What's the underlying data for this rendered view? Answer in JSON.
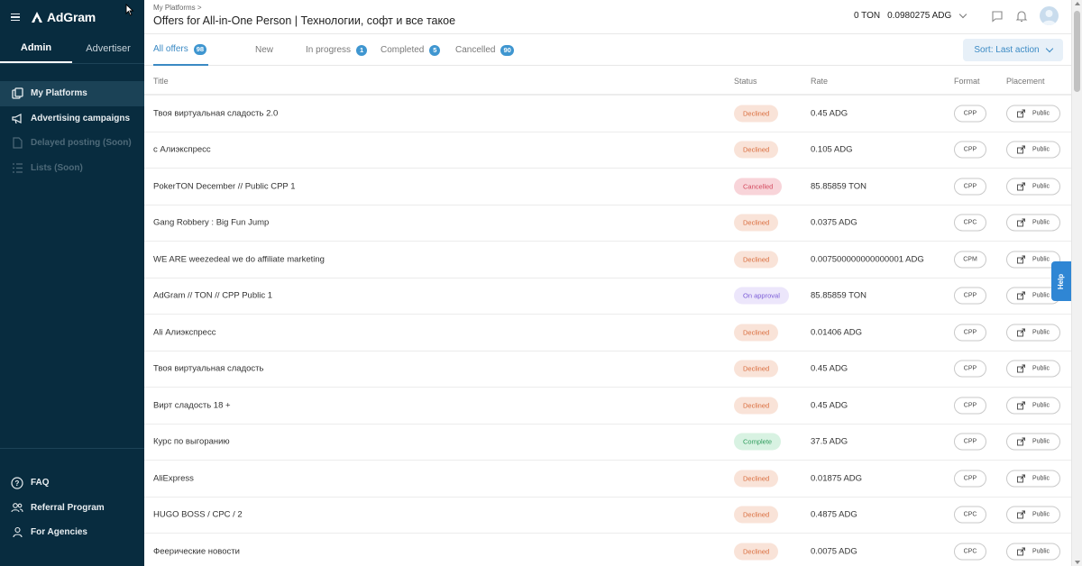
{
  "app": {
    "name": "AdGram"
  },
  "sidebar": {
    "tabs": [
      "Admin",
      "Advertiser"
    ],
    "items": [
      {
        "label": "My Platforms",
        "icon": "platforms-icon",
        "active": true,
        "disabled": false
      },
      {
        "label": "Advertising campaigns",
        "icon": "megaphone-icon",
        "active": false,
        "disabled": false
      },
      {
        "label": "Delayed posting (Soon)",
        "icon": "document-icon",
        "active": false,
        "disabled": true
      },
      {
        "label": "Lists (Soon)",
        "icon": "list-icon",
        "active": false,
        "disabled": true
      }
    ],
    "bottom_items": [
      {
        "label": "FAQ",
        "icon": "question-icon"
      },
      {
        "label": "Referral Program",
        "icon": "people-icon"
      },
      {
        "label": "For Agencies",
        "icon": "person-icon"
      }
    ]
  },
  "header": {
    "breadcrumb": "My Platforms",
    "title": "Offers for All-in-One Person | Технологии, софт и все такое",
    "balance_ton": "0 TON",
    "balance_adg": "0.0980275 ADG"
  },
  "tabs": [
    {
      "label": "All offers",
      "count": "98",
      "active": true
    },
    {
      "label": "New",
      "count": null,
      "active": false
    },
    {
      "label": "In progress",
      "count": "1",
      "active": false
    },
    {
      "label": "Completed",
      "count": "5",
      "active": false
    },
    {
      "label": "Cancelled",
      "count": "90",
      "active": false
    }
  ],
  "sort_label": "Sort: Last action",
  "table": {
    "columns": {
      "title": "Title",
      "status": "Status",
      "rate": "Rate",
      "format": "Format",
      "placement": "Placement"
    },
    "rows": [
      {
        "title": "Твоя виртуальная сладость 2.0",
        "status": "Declined",
        "status_kind": "declined",
        "rate": "0.45 ADG",
        "format": "CPP",
        "placement": "Public"
      },
      {
        "title": "с Алиэкспресс",
        "status": "Declined",
        "status_kind": "declined",
        "rate": "0.105 ADG",
        "format": "CPP",
        "placement": "Public"
      },
      {
        "title": "PokerTON December // Public CPP 1",
        "status": "Cancelled",
        "status_kind": "cancelled",
        "rate": "85.85859 TON",
        "format": "CPP",
        "placement": "Public"
      },
      {
        "title": "Gang Robbery : Big Fun Jump",
        "status": "Declined",
        "status_kind": "declined",
        "rate": "0.0375 ADG",
        "format": "CPC",
        "placement": "Public"
      },
      {
        "title": "WE ARE weezedeal we do affiliate marketing",
        "status": "Declined",
        "status_kind": "declined",
        "rate": "0.007500000000000001 ADG",
        "format": "CPM",
        "placement": "Public"
      },
      {
        "title": "AdGram // TON // CPP Public 1",
        "status": "On approval",
        "status_kind": "approval",
        "rate": "85.85859 TON",
        "format": "CPP",
        "placement": "Public"
      },
      {
        "title": "Ali Алиэкспресс",
        "status": "Declined",
        "status_kind": "declined",
        "rate": "0.01406 ADG",
        "format": "CPP",
        "placement": "Public"
      },
      {
        "title": "Твоя виртуальная сладость",
        "status": "Declined",
        "status_kind": "declined",
        "rate": "0.45 ADG",
        "format": "CPP",
        "placement": "Public"
      },
      {
        "title": "Вирт сладость 18 +",
        "status": "Declined",
        "status_kind": "declined",
        "rate": "0.45 ADG",
        "format": "CPP",
        "placement": "Public"
      },
      {
        "title": "Курс по выгоранию",
        "status": "Complete",
        "status_kind": "complete",
        "rate": "37.5 ADG",
        "format": "CPP",
        "placement": "Public"
      },
      {
        "title": "AliExpress",
        "status": "Declined",
        "status_kind": "declined",
        "rate": "0.01875 ADG",
        "format": "CPP",
        "placement": "Public"
      },
      {
        "title": "HUGO BOSS / CPC / 2",
        "status": "Declined",
        "status_kind": "declined",
        "rate": "0.4875 ADG",
        "format": "CPC",
        "placement": "Public"
      },
      {
        "title": "Феерические новости",
        "status": "Declined",
        "status_kind": "declined",
        "rate": "0.0075 ADG",
        "format": "CPC",
        "placement": "Public"
      }
    ]
  },
  "help_label": "Help",
  "colors": {
    "sidebar_bg": "#082c3f",
    "accent": "#3b8ac4",
    "help_bg": "#2f86d4"
  }
}
